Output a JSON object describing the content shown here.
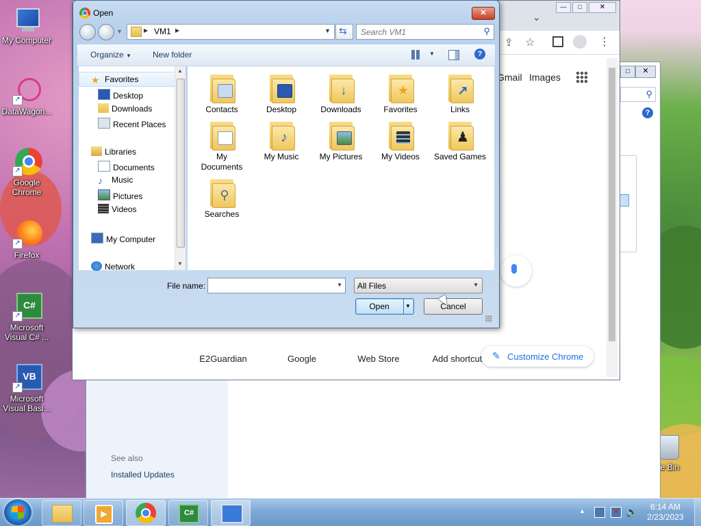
{
  "desktop": {
    "icons": [
      {
        "label": "My Computer"
      },
      {
        "label": "DataWagon..."
      },
      {
        "label": "Google Chrome"
      },
      {
        "label": "Firefox"
      },
      {
        "label": "Microsoft Visual C# ..."
      },
      {
        "label": "Microsoft Visual Basi..."
      },
      {
        "label": "ycle Bin"
      }
    ]
  },
  "chrome": {
    "gmail": "Gmail",
    "images": "Images",
    "shortcuts": [
      "E2Guardian",
      "Google",
      "Web Store",
      "Add shortcut"
    ],
    "customize": "Customize Chrome"
  },
  "control_panel": {
    "see_also": "See also",
    "installed_updates": "Installed Updates"
  },
  "dialog": {
    "title": "Open",
    "address": {
      "current": "VM1"
    },
    "search": {
      "placeholder": "Search VM1"
    },
    "toolbar": {
      "organize": "Organize",
      "new_folder": "New folder"
    },
    "nav": {
      "favorites": "Favorites",
      "favorites_items": [
        "Desktop",
        "Downloads",
        "Recent Places"
      ],
      "libraries": "Libraries",
      "libraries_items": [
        "Documents",
        "Music",
        "Pictures",
        "Videos"
      ],
      "computer": "My Computer",
      "network": "Network"
    },
    "folders": [
      {
        "label": "Contacts"
      },
      {
        "label": "Desktop"
      },
      {
        "label": "Downloads"
      },
      {
        "label": "Favorites"
      },
      {
        "label": "Links"
      },
      {
        "label": "My Documents"
      },
      {
        "label": "My Music"
      },
      {
        "label": "My Pictures"
      },
      {
        "label": "My Videos"
      },
      {
        "label": "Saved Games"
      },
      {
        "label": "Searches"
      }
    ],
    "file_name_label": "File name:",
    "file_name_value": "",
    "file_type": "All Files",
    "open_button": "Open",
    "cancel_button": "Cancel"
  },
  "taskbar": {
    "time": "6:14 AM",
    "date": "2/23/2023"
  },
  "colors": {
    "accent": "#1a73e8",
    "dialog_frame": "#c7dcf2",
    "taskbar": "#7ea9d6"
  }
}
